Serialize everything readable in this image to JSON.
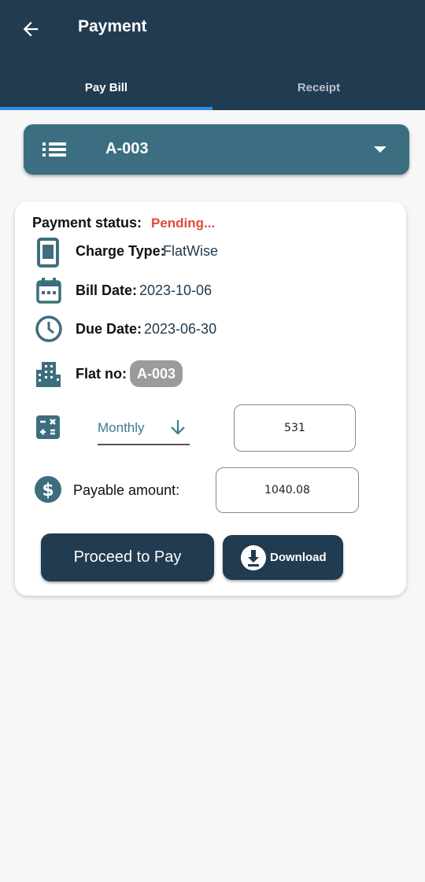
{
  "header": {
    "title": "Payment",
    "back_icon": "arrow-left-icon"
  },
  "tabs": [
    {
      "label": "Pay Bill",
      "active": true
    },
    {
      "label": "Receipt",
      "active": false
    }
  ],
  "flat_selector": {
    "value": "A-003",
    "icon": "list-icon",
    "caret_icon": "caret-down-icon"
  },
  "card": {
    "payment_status_label": "Payment status:",
    "payment_status_value": "Pending...",
    "charge_type_label": "Charge Type:",
    "charge_type_value": "FlatWise",
    "bill_date_label": "Bill Date:",
    "bill_date_value": "2023-10-06",
    "due_date_label": "Due Date:",
    "due_date_value": "2023-06-30",
    "flat_no_label": "Flat no:",
    "flat_no_value": "A-003",
    "period_select": "Monthly",
    "period_input": "531",
    "payable_label": "Payable amount:",
    "payable_value": "1040.08"
  },
  "buttons": {
    "proceed": "Proceed to Pay",
    "download": "Download"
  },
  "colors": {
    "appbar": "#213b51",
    "tab_indicator": "#2f8ee0",
    "dropdown_bg": "#3a6e80",
    "pending": "#e04a3a",
    "icon": "#3c6e7e"
  }
}
